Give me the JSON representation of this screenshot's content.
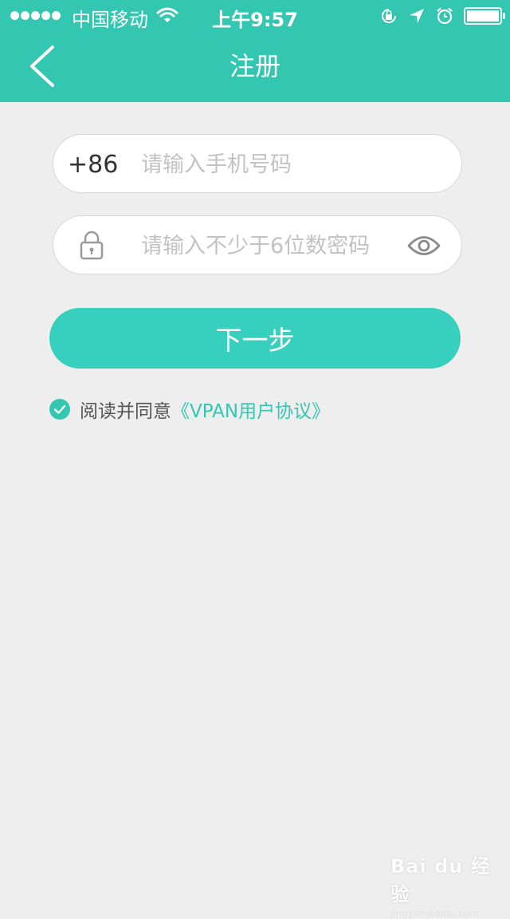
{
  "status_bar": {
    "carrier": "中国移动",
    "time": "上午9:57"
  },
  "nav": {
    "title": "注册"
  },
  "phone_field": {
    "prefix": "+86",
    "placeholder": "请输入手机号码",
    "value": ""
  },
  "password_field": {
    "placeholder": "请输入不少于6位数密码",
    "value": ""
  },
  "next_button": {
    "label": "下一步"
  },
  "agreement": {
    "text": "阅读并同意",
    "link": "《VPAN用户协议》",
    "checked": true
  },
  "watermark": {
    "main": "Bai du 经验",
    "sub": "jingyan.baidu.com"
  },
  "colors": {
    "accent": "#33c6b1",
    "button": "#37d0be",
    "background": "#eeeeee"
  }
}
